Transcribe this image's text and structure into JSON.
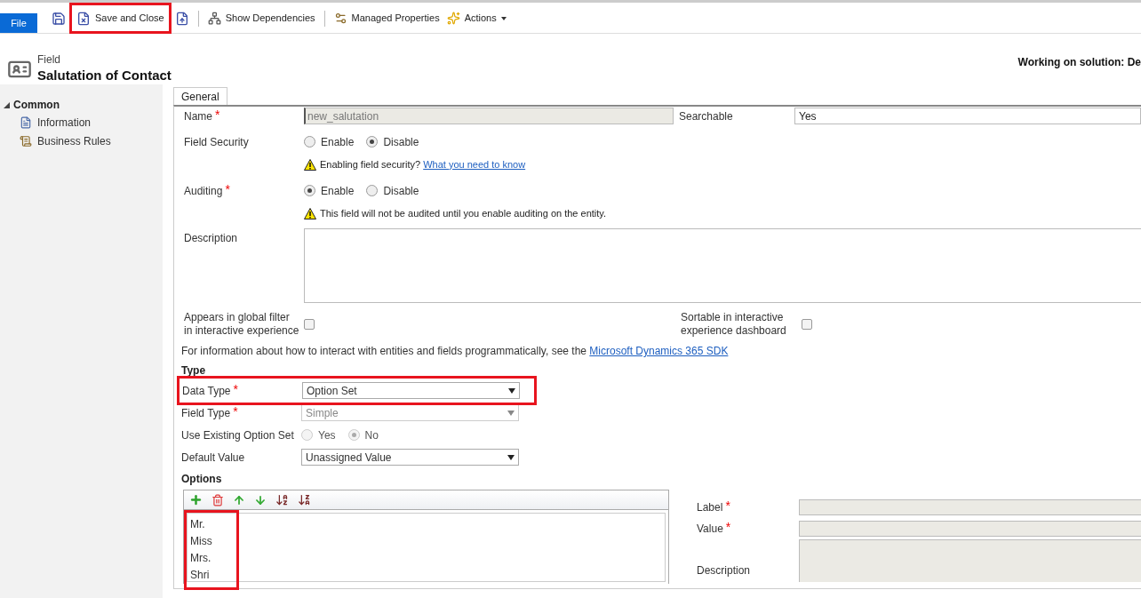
{
  "toolbar": {
    "file_tab": "File",
    "buttons": [
      {
        "kind": "save"
      },
      {
        "kind": "save_close",
        "label": "Save and Close",
        "highlighted": true
      },
      {
        "kind": "publish"
      },
      {
        "kind": "separator"
      },
      {
        "kind": "dependencies",
        "label": "Show Dependencies"
      },
      {
        "kind": "separator"
      },
      {
        "kind": "managed",
        "label": "Managed Properties"
      },
      {
        "kind": "actions",
        "label": "Actions"
      }
    ]
  },
  "header": {
    "entity": "Field",
    "title": "Salutation of Contact",
    "solution": "Working on solution: De"
  },
  "sidebar": {
    "groups": [
      {
        "label": "Common",
        "expanded": true,
        "children": [
          {
            "label": "Information",
            "kind": "info"
          },
          {
            "label": "Business Rules",
            "kind": "rules"
          }
        ]
      }
    ]
  },
  "tabs": [
    {
      "label": "General",
      "selected": true
    }
  ],
  "form": {
    "name": {
      "label": "Name",
      "required_mark": "*",
      "value": "new_salutation",
      "disabled": true
    },
    "searchable": {
      "label": "Searchable",
      "value": "Yes"
    },
    "field_security": {
      "label": "Field Security",
      "options": [
        {
          "label": "Enable",
          "selected": false
        },
        {
          "label": "Disable",
          "selected": true
        }
      ],
      "warning": {
        "text": "Enabling field security?",
        "link": "What you need to know"
      }
    },
    "auditing": {
      "label": "Auditing",
      "required_mark": "*",
      "options": [
        {
          "label": "Enable",
          "selected": true
        },
        {
          "label": "Disable",
          "selected": false
        }
      ],
      "warning": {
        "text": "This field will not be audited until you enable auditing on the entity."
      }
    },
    "description": {
      "label": "Description"
    },
    "global_filter": {
      "label": "Appears in global filter in interactive experience",
      "checked": false
    },
    "sortable": {
      "label": "Sortable in interactive experience dashboard",
      "checked": false
    },
    "sdk_note": {
      "text": "For information about how to interact with entities and fields programmatically, see the",
      "link": "Microsoft Dynamics 365 SDK"
    }
  },
  "type_section": {
    "heading": "Type",
    "data_type": {
      "label": "Data Type",
      "required_mark": "*",
      "value": "Option Set",
      "highlighted": true,
      "disabled": false
    },
    "field_type": {
      "label": "Field Type",
      "required_mark": "*",
      "value": "Simple",
      "disabled": true
    },
    "use_existing": {
      "label": "Use Existing Option Set",
      "disabled": true,
      "options": [
        {
          "label": "Yes",
          "selected": false
        },
        {
          "label": "No",
          "selected": true
        }
      ]
    },
    "default_value": {
      "label": "Default Value",
      "value": "Unassigned Value",
      "disabled": false
    }
  },
  "options_section": {
    "heading": "Options",
    "tools": [
      {
        "kind": "add"
      },
      {
        "kind": "delete"
      },
      {
        "kind": "up"
      },
      {
        "kind": "down"
      },
      {
        "kind": "sort_az"
      },
      {
        "kind": "sort_za"
      }
    ],
    "items_highlighted": true,
    "items": [
      {
        "label": "Mr."
      },
      {
        "label": "Miss"
      },
      {
        "label": "Mrs."
      },
      {
        "label": "Shri"
      }
    ],
    "label_field": {
      "label": "Label",
      "required_mark": "*"
    },
    "value_field": {
      "label": "Value",
      "required_mark": "*"
    },
    "description_field": {
      "label": "Description"
    }
  }
}
